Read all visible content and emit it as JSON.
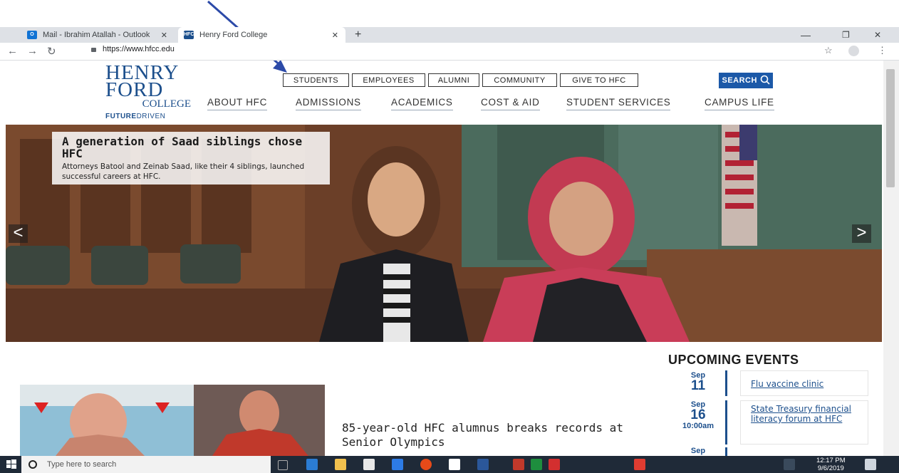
{
  "browser": {
    "tabs": [
      {
        "label": "Mail - Ibrahim Atallah - Outlook",
        "favicon": "outlook-icon"
      },
      {
        "label": "Henry Ford College",
        "favicon": "hfc-icon"
      }
    ],
    "new_tab": "+",
    "url": "https://www.hfcc.edu",
    "window_controls": [
      "—",
      "❐",
      "✕"
    ]
  },
  "site": {
    "logo": {
      "line1": "HENRY",
      "line2": "FORD",
      "line3": "COLLEGE",
      "tag_bold": "FUTURE",
      "tag_light": "DRIVEN"
    },
    "utility_nav": [
      "STUDENTS",
      "EMPLOYEES",
      "ALUMNI",
      "COMMUNITY",
      "GIVE TO HFC"
    ],
    "search_label": "SEARCH",
    "main_nav": [
      "ABOUT HFC",
      "ADMISSIONS",
      "ACADEMICS",
      "COST & AID",
      "STUDENT SERVICES",
      "CAMPUS LIFE"
    ],
    "hero": {
      "title": "A generation of Saad siblings chose HFC",
      "description": "Attorneys Batool and Zeinab Saad, like their 4 siblings, launched successful careers at HFC.",
      "prev": "<",
      "next": ">"
    },
    "news": {
      "headline": "85-year-old HFC alumnus breaks records at Senior Olympics"
    },
    "events": {
      "title": "UPCOMING EVENTS",
      "items": [
        {
          "month": "Sep",
          "day": "11",
          "time": "",
          "title": "Flu vaccine clinic"
        },
        {
          "month": "Sep",
          "day": "16",
          "time": "10:00am",
          "title": "State Treasury financial literacy forum at HFC"
        },
        {
          "month": "Sep",
          "day": "",
          "time": "",
          "title": ""
        }
      ]
    }
  },
  "taskbar": {
    "search_placeholder": "Type here to search",
    "time": "12:17 PM",
    "date": "9/6/2019"
  },
  "colors": {
    "brand_blue": "#1c4f8c",
    "search_blue": "#1c59a8",
    "annotation_arrow": "#2c4aa8"
  }
}
